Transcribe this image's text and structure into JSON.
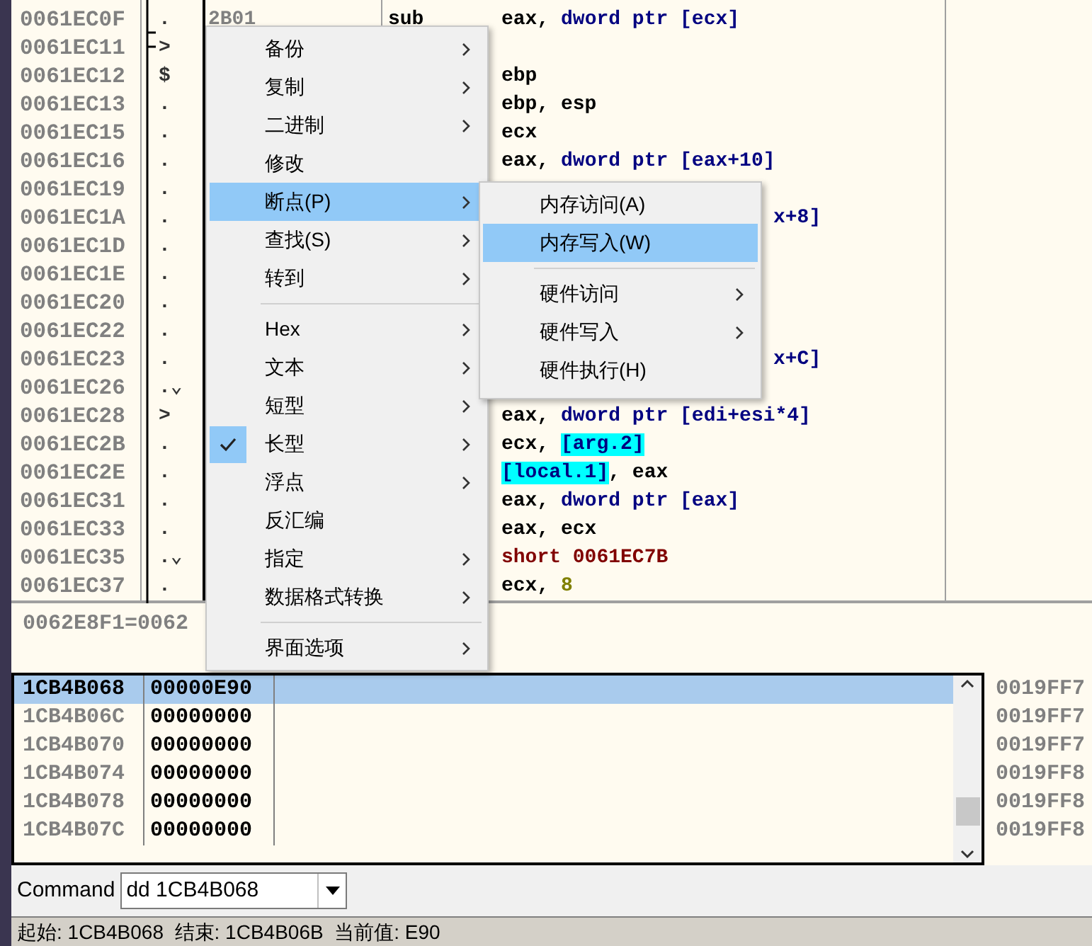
{
  "disassembly": {
    "rows": [
      {
        "address": "0061EC0F",
        "mark": ".",
        "opcode": "2B01",
        "mnemonic": "sub",
        "operand": [
          {
            "text": "eax, ",
            "kind": "reg"
          },
          {
            "text": "dword ptr [ecx]",
            "kind": "mem"
          }
        ]
      },
      {
        "address": "0061EC11",
        "mark": ">"
      },
      {
        "address": "0061EC12",
        "mark": "$",
        "operand": [
          {
            "text": "ebp",
            "kind": "reg"
          }
        ]
      },
      {
        "address": "0061EC13",
        "mark": ".",
        "operand": [
          {
            "text": "ebp, esp",
            "kind": "reg"
          }
        ]
      },
      {
        "address": "0061EC15",
        "mark": ".",
        "operand": [
          {
            "text": "ecx",
            "kind": "reg"
          }
        ]
      },
      {
        "address": "0061EC16",
        "mark": ".",
        "operand": [
          {
            "text": "eax, ",
            "kind": "reg"
          },
          {
            "text": "dword ptr [eax+10]",
            "kind": "mem"
          }
        ]
      },
      {
        "address": "0061EC19",
        "mark": "."
      },
      {
        "address": "0061EC1A",
        "mark": ".",
        "cut": true,
        "operand": [
          {
            "text": "x+8]",
            "kind": "mem"
          }
        ]
      },
      {
        "address": "0061EC1D",
        "mark": "."
      },
      {
        "address": "0061EC1E",
        "mark": "."
      },
      {
        "address": "0061EC20",
        "mark": "."
      },
      {
        "address": "0061EC22",
        "mark": "."
      },
      {
        "address": "0061EC23",
        "mark": ".",
        "cut": true,
        "operand": [
          {
            "text": "x+C]",
            "kind": "mem"
          }
        ]
      },
      {
        "address": "0061EC26",
        "mark": ".⌄"
      },
      {
        "address": "0061EC28",
        "mark": ">",
        "operand": [
          {
            "text": "eax, ",
            "kind": "reg"
          },
          {
            "text": "dword ptr [edi+esi*4]",
            "kind": "mem"
          }
        ]
      },
      {
        "address": "0061EC2B",
        "mark": ".",
        "operand": [
          {
            "text": "ecx, ",
            "kind": "reg"
          },
          {
            "text": "[arg.2]",
            "kind": "hl"
          }
        ]
      },
      {
        "address": "0061EC2E",
        "mark": ".",
        "operand": [
          {
            "text": "[local.1]",
            "kind": "hl"
          },
          {
            "text": ", eax",
            "kind": "reg"
          }
        ]
      },
      {
        "address": "0061EC31",
        "mark": ".",
        "operand": [
          {
            "text": "eax, ",
            "kind": "reg"
          },
          {
            "text": "dword ptr [eax]",
            "kind": "mem"
          }
        ]
      },
      {
        "address": "0061EC33",
        "mark": ".",
        "operand": [
          {
            "text": "eax, ecx",
            "kind": "reg"
          }
        ]
      },
      {
        "address": "0061EC35",
        "mark": ".⌄",
        "operand": [
          {
            "text": "short 0061EC7B",
            "kind": "jmp"
          }
        ]
      },
      {
        "address": "0061EC37",
        "mark": ".",
        "operand": [
          {
            "text": "ecx, ",
            "kind": "reg"
          },
          {
            "text": "8",
            "kind": "num"
          }
        ]
      }
    ]
  },
  "info": "0062E8F1=0062",
  "dump": {
    "rows": [
      {
        "address": "1CB4B068",
        "value": "00000E90",
        "selected": true
      },
      {
        "address": "1CB4B06C",
        "value": "00000000",
        "selected": false
      },
      {
        "address": "1CB4B070",
        "value": "00000000",
        "selected": false
      },
      {
        "address": "1CB4B074",
        "value": "00000000",
        "selected": false
      },
      {
        "address": "1CB4B078",
        "value": "00000000",
        "selected": false
      },
      {
        "address": "1CB4B07C",
        "value": "00000000",
        "selected": false
      }
    ]
  },
  "stack": [
    "0019FF7",
    "0019FF7",
    "0019FF7",
    "0019FF8",
    "0019FF8",
    "0019FF8"
  ],
  "command": {
    "label": "Command",
    "value": "dd 1CB4B068"
  },
  "status": "起始: 1CB4B068  结束: 1CB4B06B  当前值: E90",
  "context_menu": [
    {
      "kind": "item",
      "label": "备份",
      "submenu": true,
      "selected": false,
      "checked": false
    },
    {
      "kind": "item",
      "label": "复制",
      "submenu": true,
      "selected": false,
      "checked": false
    },
    {
      "kind": "item",
      "label": "二进制",
      "submenu": true,
      "selected": false,
      "checked": false
    },
    {
      "kind": "item",
      "label": "修改",
      "submenu": false,
      "selected": false,
      "checked": false
    },
    {
      "kind": "item",
      "label": "断点(P)",
      "submenu": true,
      "selected": true,
      "checked": false
    },
    {
      "kind": "item",
      "label": "查找(S)",
      "submenu": true,
      "selected": false,
      "checked": false
    },
    {
      "kind": "item",
      "label": "转到",
      "submenu": true,
      "selected": false,
      "checked": false
    },
    {
      "kind": "separator"
    },
    {
      "kind": "item",
      "label": "Hex",
      "submenu": true,
      "selected": false,
      "checked": false
    },
    {
      "kind": "item",
      "label": "文本",
      "submenu": true,
      "selected": false,
      "checked": false
    },
    {
      "kind": "item",
      "label": "短型",
      "submenu": true,
      "selected": false,
      "checked": false
    },
    {
      "kind": "item",
      "label": "长型",
      "submenu": true,
      "selected": false,
      "checked": true
    },
    {
      "kind": "item",
      "label": "浮点",
      "submenu": true,
      "selected": false,
      "checked": false
    },
    {
      "kind": "item",
      "label": "反汇编",
      "submenu": false,
      "selected": false,
      "checked": false
    },
    {
      "kind": "item",
      "label": "指定",
      "submenu": true,
      "selected": false,
      "checked": false
    },
    {
      "kind": "item",
      "label": "数据格式转换",
      "submenu": true,
      "selected": false,
      "checked": false
    },
    {
      "kind": "separator"
    },
    {
      "kind": "item",
      "label": "界面选项",
      "submenu": true,
      "selected": false,
      "checked": false
    }
  ],
  "submenu": [
    {
      "kind": "item",
      "label": "内存访问(A)",
      "submenu": false,
      "selected": false
    },
    {
      "kind": "item",
      "label": "内存写入(W)",
      "submenu": false,
      "selected": true
    },
    {
      "kind": "separator"
    },
    {
      "kind": "item",
      "label": "硬件访问",
      "submenu": true,
      "selected": false
    },
    {
      "kind": "item",
      "label": "硬件写入",
      "submenu": true,
      "selected": false
    },
    {
      "kind": "item",
      "label": "硬件执行(H)",
      "submenu": false,
      "selected": false
    }
  ]
}
